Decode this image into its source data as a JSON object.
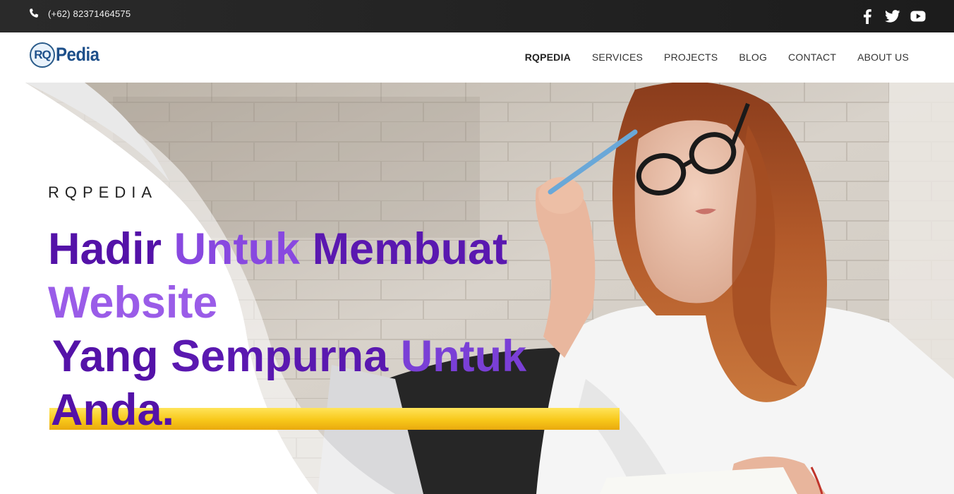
{
  "topbar": {
    "phone": "(+62) 82371464575",
    "icons": [
      "phone-icon",
      "facebook-icon",
      "twitter-icon",
      "youtube-icon"
    ]
  },
  "header": {
    "logo": {
      "mark": "RQ",
      "word": "Pedia"
    },
    "nav": [
      {
        "label": "RQPEDIA",
        "active": true
      },
      {
        "label": "SERVICES",
        "active": false
      },
      {
        "label": "PROJECTS",
        "active": false
      },
      {
        "label": "BLOG",
        "active": false
      },
      {
        "label": "CONTACT",
        "active": false
      },
      {
        "label": "ABOUT US",
        "active": false
      }
    ]
  },
  "hero": {
    "kicker": "RQPEDIA",
    "headline": {
      "w1": "Hadir",
      "w2": "Untuk",
      "w3": "Membuat",
      "w4": "Website",
      "w5": "Yang",
      "w6": "Sempurna",
      "w7": "Untuk",
      "w8": "Anda."
    }
  },
  "colors": {
    "topbar": "#1c1c1c",
    "brand_blue": "#1d4f8a",
    "purple_dark": "#5412a8",
    "purple_light": "#8848e0",
    "highlight_yellow": "#f8c81a"
  }
}
